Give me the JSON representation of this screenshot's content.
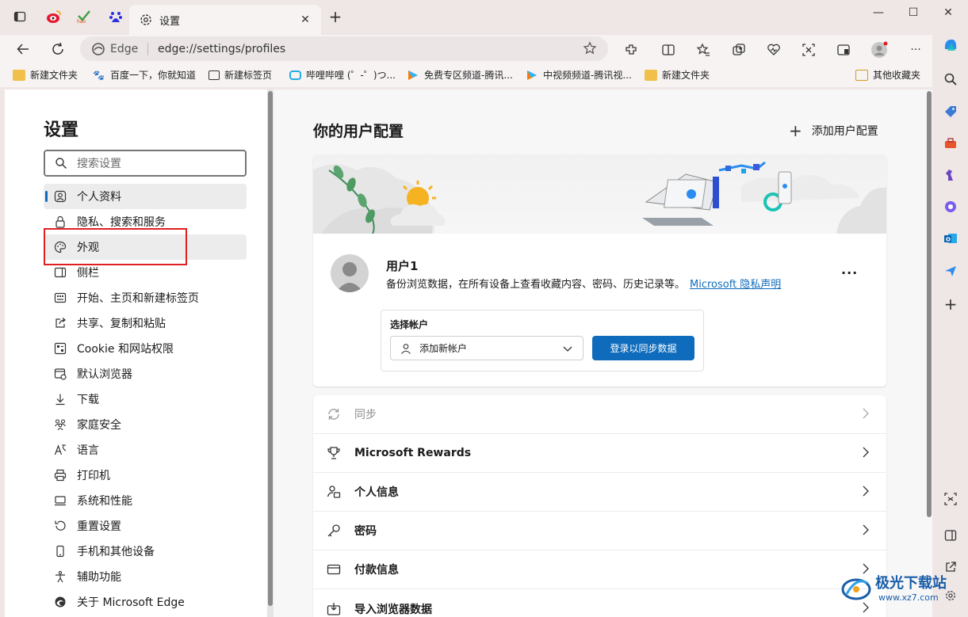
{
  "tabs": {
    "active_title": "设置"
  },
  "address_bar": {
    "site_label": "Edge",
    "url": "edge://settings/profiles"
  },
  "bookmarks": [
    {
      "label": "新建文件夹",
      "icon": "folder-icon"
    },
    {
      "label": "百度一下，你就知道",
      "icon": "baidu-icon"
    },
    {
      "label": "新建标签页",
      "icon": "newtab-icon"
    },
    {
      "label": "哔哩哔哩 (゜-゜)つ...",
      "icon": "bilibili-icon"
    },
    {
      "label": "免费专区频道-腾讯...",
      "icon": "video-icon"
    },
    {
      "label": "中视频频道-腾讯视...",
      "icon": "video-icon"
    },
    {
      "label": "新建文件夹",
      "icon": "folder-icon"
    },
    {
      "label": "其他收藏夹",
      "icon": "folder-icon"
    }
  ],
  "settings": {
    "title": "设置",
    "search_placeholder": "搜索设置",
    "nav": [
      {
        "label": "个人资料",
        "icon": "profile-icon"
      },
      {
        "label": "隐私、搜索和服务",
        "icon": "lock-icon"
      },
      {
        "label": "外观",
        "icon": "palette-icon"
      },
      {
        "label": "侧栏",
        "icon": "sidebar-icon"
      },
      {
        "label": "开始、主页和新建标签页",
        "icon": "home-icon"
      },
      {
        "label": "共享、复制和粘贴",
        "icon": "share-icon"
      },
      {
        "label": "Cookie 和网站权限",
        "icon": "cookie-icon"
      },
      {
        "label": "默认浏览器",
        "icon": "browser-icon"
      },
      {
        "label": "下载",
        "icon": "download-icon"
      },
      {
        "label": "家庭安全",
        "icon": "family-icon"
      },
      {
        "label": "语言",
        "icon": "language-icon"
      },
      {
        "label": "打印机",
        "icon": "printer-icon"
      },
      {
        "label": "系统和性能",
        "icon": "system-icon"
      },
      {
        "label": "重置设置",
        "icon": "reset-icon"
      },
      {
        "label": "手机和其他设备",
        "icon": "phone-icon"
      },
      {
        "label": "辅助功能",
        "icon": "accessibility-icon"
      },
      {
        "label": "关于 Microsoft Edge",
        "icon": "edge-icon"
      }
    ]
  },
  "profiles": {
    "heading": "你的用户配置",
    "add_profile": "添加用户配置",
    "user_name": "用户1",
    "user_desc": "备份浏览数据，在所有设备上查看收藏内容、密码、历史记录等。",
    "privacy_link": "Microsoft 隐私声明",
    "select_account_label": "选择帐户",
    "add_account": "添加新帐户",
    "sign_in_button": "登录以同步数据",
    "rows": [
      {
        "label": "同步",
        "icon": "sync-icon",
        "disabled": true
      },
      {
        "label": "Microsoft Rewards",
        "icon": "trophy-icon"
      },
      {
        "label": "个人信息",
        "icon": "personal-info-icon"
      },
      {
        "label": "密码",
        "icon": "key-icon"
      },
      {
        "label": "付款信息",
        "icon": "card-icon"
      },
      {
        "label": "导入浏览器数据",
        "icon": "import-icon"
      }
    ]
  },
  "watermark": {
    "text": "极光下载站",
    "url": "www.xz7.com"
  },
  "colors": {
    "accent": "#0f6cbd",
    "highlight_box": "#e02020"
  }
}
